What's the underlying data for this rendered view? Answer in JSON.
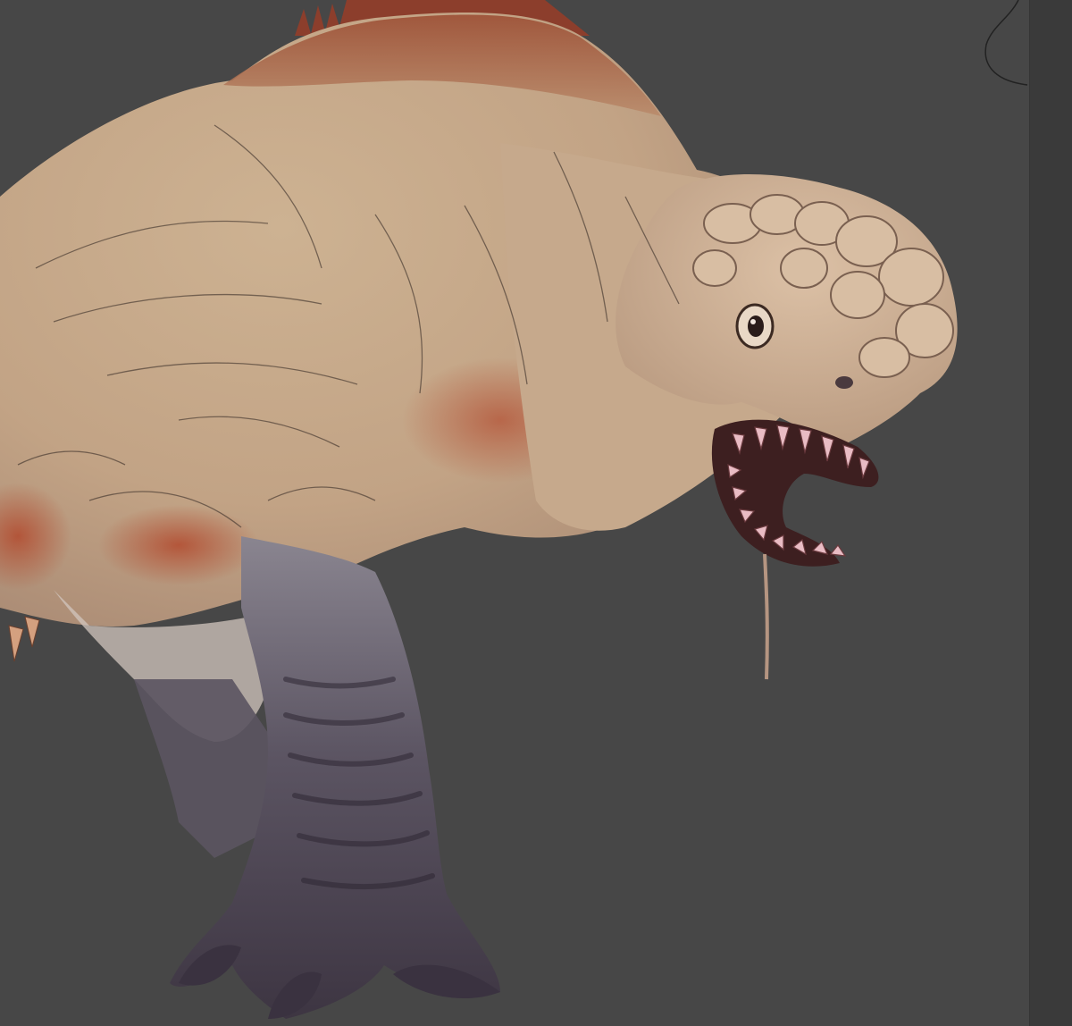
{
  "app": {
    "canvas_background": "#474747",
    "panel_background": "#3a3a3a"
  },
  "artwork": {
    "subject": "creature-illustration",
    "palette": {
      "skin_light": "#c9ad8c",
      "skin_mid": "#b89a7c",
      "flesh_red": "#a3452c",
      "mouth_dark": "#3c1e1e",
      "teeth": "#e7b7c0",
      "leg_shadow": "#5a5260",
      "leg_dark": "#3e3743",
      "lineart": "#2c2420"
    }
  }
}
